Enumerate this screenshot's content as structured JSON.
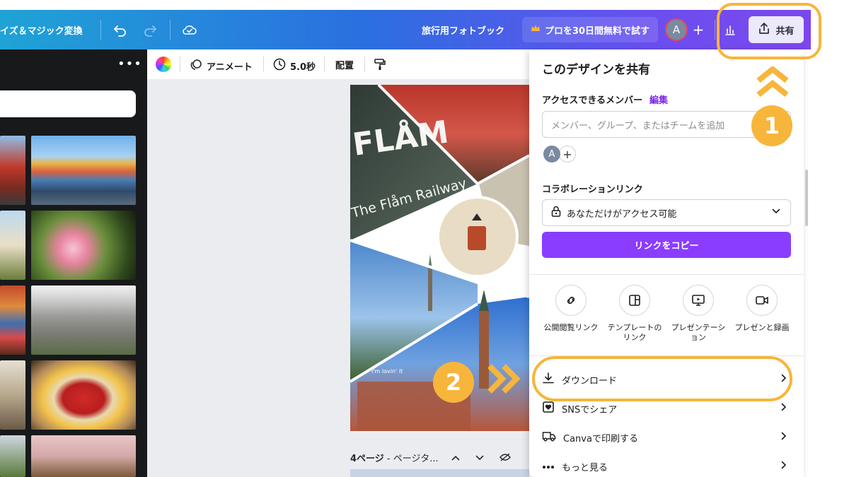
{
  "topbar": {
    "resize_label": "イズ＆マジック変換",
    "doc_title": "旅行用フォトブック",
    "pro_label": "プロを30日間無料で試す",
    "avatar_letter": "A",
    "add_symbol": "+",
    "share_label": "共有"
  },
  "canvas_toolbar": {
    "animate_label": "アニメート",
    "duration_label": "5.0秒",
    "position_label": "配置"
  },
  "page_status": {
    "page_label": "4ページ",
    "separator": " - ",
    "page_title_placeholder": "ページタ..."
  },
  "photo_text": {
    "sign_line1": "FLÅM",
    "sign_line2": "The Flåm Railway",
    "sign_small": "I'm lovin' it"
  },
  "share_panel": {
    "title": "このデザインを共有",
    "access_label": "アクセスできるメンバー",
    "edit_link": "編集",
    "member_placeholder": "メンバー、グループ、またはチームを追加",
    "avatar_letter": "A",
    "add_symbol": "+",
    "collab_label": "コラボレーションリンク",
    "link_setting": "あなただけがアクセス可能",
    "copy_button": "リンクをコピー",
    "options": [
      {
        "label": "公開閲覧リンク",
        "icon": "link-icon"
      },
      {
        "label": "テンプレートのリンク",
        "icon": "template-icon"
      },
      {
        "label": "プレゼンテーション",
        "icon": "presentation-icon"
      },
      {
        "label": "プレゼンと録画",
        "icon": "record-icon"
      }
    ],
    "rows": [
      {
        "label": "ダウンロード",
        "icon": "download-icon"
      },
      {
        "label": "SNSでシェア",
        "icon": "heart-icon"
      },
      {
        "label": "Canvaで印刷する",
        "icon": "truck-icon"
      },
      {
        "label": "もっと見る",
        "icon": "more-icon"
      }
    ]
  },
  "annotations": {
    "step1": "1",
    "step2": "2"
  },
  "colors": {
    "accent": "#8b3dff",
    "annotation": "#f7b53b",
    "edit_link": "#7d2ae8"
  }
}
